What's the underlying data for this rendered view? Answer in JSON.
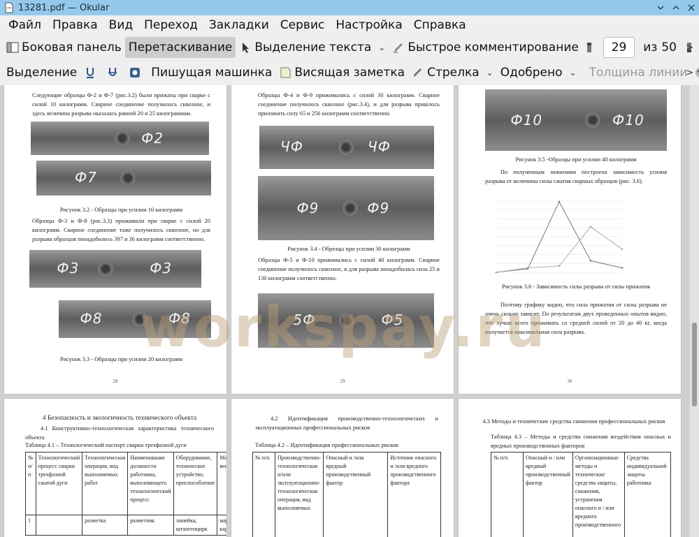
{
  "window": {
    "title": "13281.pdf  — Okular"
  },
  "menu": [
    "Файл",
    "Правка",
    "Вид",
    "Переход",
    "Закладки",
    "Сервис",
    "Настройка",
    "Справка"
  ],
  "toolbar1": {
    "sidebar": "Боковая панель",
    "drag": "Перетаскивание",
    "text_select": "Выделение текста",
    "quick_comment": "Быстрое комментирование",
    "page_current": "29",
    "page_of": "из",
    "page_total": "50"
  },
  "toolbar2": {
    "selection": "Выделение",
    "typewriter": "Пишущая машинка",
    "sticky_note": "Висящая заметка",
    "arrow": "Стрелка",
    "approved": "Одобрено",
    "line_width": "Толщина линии"
  },
  "watermark": "workspay.ru",
  "pages": {
    "p28": {
      "para1": "Следующие образцы Ф-2 и Ф-7 (рис.3.2) были прижаты при сварке с силой 10 килограмм. Сварное соединение получилось сквозное, и здесь величина разрыва оказалась равной 20 и 25 килограммам.",
      "marks1": [
        "Ф2",
        "Ф7"
      ],
      "caption1": "Рисунок 3.2 - Образцы при усилии 10 килограмм",
      "para2": "Образцы Ф-3 и Ф-8 (рис.3.3) прижимали при сварке с силой 20 килограмм. Сварное соединение тоже получилось сквозное, но для разрыва образцов понадобилось 397 и 36 килограмм соответственно.",
      "marks2": [
        "Ф3",
        "Ф3",
        "Ф8",
        "Ф8"
      ],
      "caption2": "Рисунок 3.3 - Образцы при усилии 20 килограмм",
      "num": "28"
    },
    "p29": {
      "para1": "Образцы Ф-4 и Ф-9 прижимались с силой 30 килограмм. Сварное соединение получилось сквозное (рис.3.4), и для разрыва пришлось приложить силу 65 и 256 килограмм соответственно.",
      "marks1": [
        "ЧФ",
        "ЧФ",
        "Ф9",
        "Ф9"
      ],
      "caption1": "Рисунок 3.4 - Образцы при усилии 30 килограмм",
      "para2": "Образцы Ф-5 и Ф-10 прижимались с силой 40 килограмм. Сварное соединение получилось сквозное, и для разрыва понадобилась сила 25 и 130 килограмм соответственно.",
      "marks2": [
        "5Ф",
        "Ф5"
      ],
      "num": "29"
    },
    "p30": {
      "marks1": [
        "Ф10",
        "Ф10"
      ],
      "caption1": "Рисунок 3.5 -Образцы при усилии 40 килограмм",
      "para1": "По полученным значениям построена зависимость усилия разрыва от величины силы сжатия сварных образцов (рис. 3.6).",
      "caption2": "Рисунок 3.6 - Зависимость силы разрыва от силы прижатия",
      "para2": "Поэтому графику видно, что сила прижатия от силы разрыва не очень сильно зависит. По результатам двух проведенных опытов видно, что лучше всего прижимать со средней силой от 20 до 40 кг, когда получается максимальная сила разрыва.",
      "num": "30"
    },
    "p31": {
      "heading": "4 Безопасность и экологичность технического объекта",
      "sub": "4.1 Конструктивно-технологическая характеристика технического объекта",
      "table_caption": "Таблица 4.1 – Технологический паспорт сварки трехфазной дуги",
      "headers": [
        "№ п/п",
        "Технологический процесс сварки трехфазной сжатой дуги",
        "Технологическая операция, вид выполняемых работ",
        "Наименование должности работника, выполняющего технологический процесс",
        "Оборудование, техническое устройство, приспособление",
        "Материалы, вещества"
      ],
      "row1": [
        "1",
        "",
        "разметка",
        "разметчик",
        "линейка, штангенцирк",
        "маркер, карандаш"
      ]
    },
    "p32": {
      "heading": "4.2 Идентификация производственно-технологических и эксплуатационных профессиональных рисков",
      "table_caption": "Таблица 4.2 – Идентификация профессиональных рисков",
      "headers": [
        "№ п/п",
        "Производственно-технологическая и/или эксплуатационно-технологическая операция, вид выполняемых",
        "Опасный и /или вредный производственный фактор",
        "Источник опасного и /или вредного производственного фактора"
      ]
    },
    "p33": {
      "heading": "4.3 Методы и технические средства снижения профессиональных рисков",
      "table_caption": "Таблица 4.3 – Методы и средства снижения воздействия опасных и вредных производственных факторов",
      "headers": [
        "№ п/п",
        "Опасный и / или вредный производственный фактор",
        "Организационные методы и технические средства защиты, снижения, устранения опасного и / или вредного производственного",
        "Средства индивидуальной защиты работника"
      ]
    }
  },
  "chart_data": {
    "type": "line",
    "x": [
      1,
      2,
      3,
      4,
      5
    ],
    "series": [
      {
        "values": [
          0,
          20,
          397,
          65,
          25
        ]
      },
      {
        "values": [
          0,
          25,
          36,
          256,
          130
        ]
      }
    ]
  }
}
